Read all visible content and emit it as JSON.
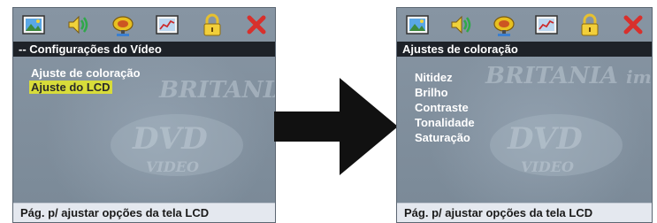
{
  "left_screen": {
    "icons": [
      "image-icon",
      "speaker-icon",
      "satellite-icon",
      "chart-icon",
      "lock-icon",
      "close-icon"
    ],
    "title": "-- Configurações do Vídeo",
    "menu": [
      {
        "label": "Ajuste de coloração",
        "selected": false
      },
      {
        "label": "Ajuste do LCD",
        "selected": true
      }
    ],
    "footer": "Pág. p/ ajustar opções da tela LCD"
  },
  "right_screen": {
    "icons": [
      "image-icon",
      "speaker-icon",
      "satellite-icon",
      "chart-icon",
      "lock-icon",
      "close-icon"
    ],
    "title": "Ajustes de coloração",
    "menu": [
      {
        "label": "Nitidez"
      },
      {
        "label": "Brilho"
      },
      {
        "label": "Contraste"
      },
      {
        "label": "Tonalidade"
      },
      {
        "label": "Saturação"
      }
    ],
    "footer": "Pág. p/ ajustar opções da tela LCD"
  },
  "colors": {
    "title_bar": "#1e2228",
    "highlight": "#d8dc3a",
    "arrow": "#111111",
    "screen_bg": "#7f8e9c"
  }
}
